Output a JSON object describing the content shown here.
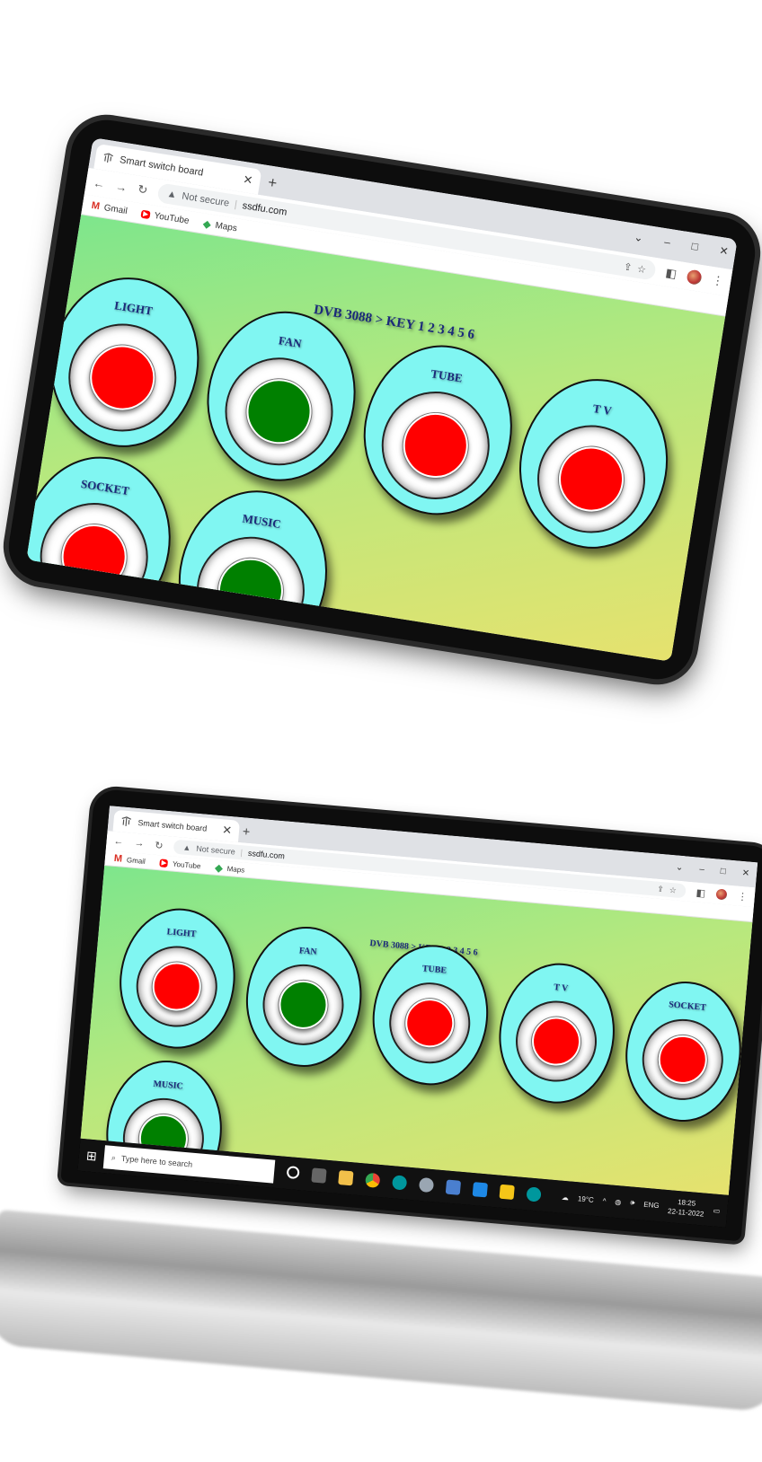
{
  "browser": {
    "tab_title": "Smart switch board",
    "tab_close": "✕",
    "new_tab": "+",
    "security_label": "Not secure",
    "url": "ssdfu.com",
    "bookmarks": [
      {
        "label": "Gmail",
        "icon": "gmail-icon"
      },
      {
        "label": "YouTube",
        "icon": "youtube-icon"
      },
      {
        "label": "Maps",
        "icon": "maps-icon"
      }
    ],
    "window_controls": {
      "minimize": "–",
      "maximize": "□",
      "close": "✕",
      "dropdown": "⌄"
    }
  },
  "page": {
    "title": "DVB 3088 > KEY 1 2 3 4 5 6",
    "switches": [
      {
        "label": "LIGHT",
        "state": "off",
        "color": "#ff0000"
      },
      {
        "label": "FAN",
        "state": "on",
        "color": "#008000"
      },
      {
        "label": "TUBE",
        "state": "off",
        "color": "#ff0000"
      },
      {
        "label": "T V",
        "state": "off",
        "color": "#ff0000"
      },
      {
        "label": "SOCKET",
        "state": "off",
        "color": "#ff0000"
      },
      {
        "label": "MUSIC",
        "state": "on",
        "color": "#008000"
      }
    ]
  },
  "taskbar": {
    "search_placeholder": "Type here to search",
    "weather": "19°C",
    "language": "ENG",
    "time": "18:25",
    "date": "22-11-2022"
  },
  "colors": {
    "card_bg": "#80f6f2",
    "on": "#008000",
    "off": "#ff0000",
    "title_text": "#1b2a7a"
  }
}
